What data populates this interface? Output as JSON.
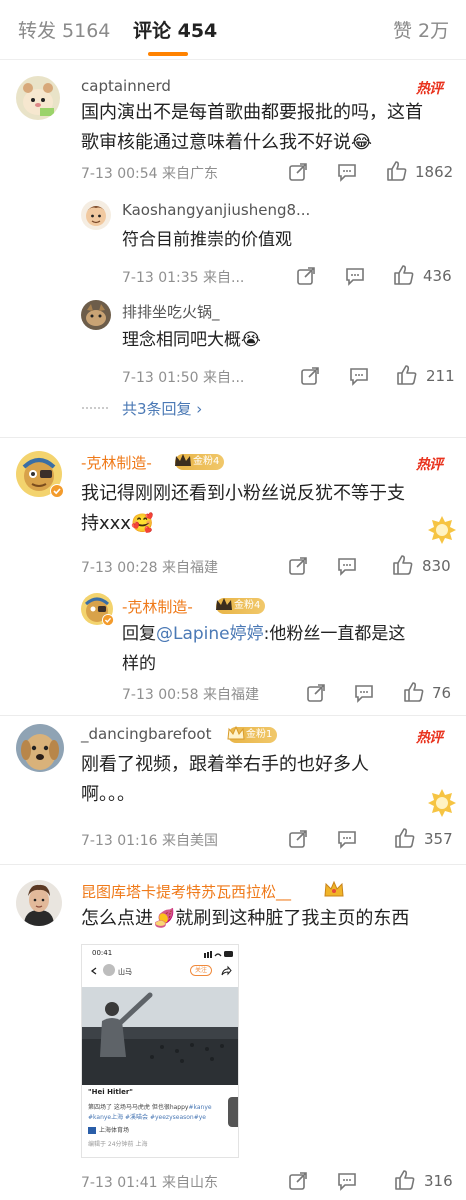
{
  "tabs": {
    "repost_label": "转发 5164",
    "comments_label": "评论 454",
    "likes_label": "赞 2万"
  },
  "comments": [
    {
      "username": "captainnerd",
      "hot_label": "热评",
      "text_lines": [
        "国内演出不是每首歌曲都要报批的吗，这首",
        "歌审核能通过意味着什么我不好说😂"
      ],
      "meta": "7-13 00:54  来自广东",
      "likes": "1862",
      "replies": [
        {
          "username": "Kaoshangyanjiusheng8...",
          "text": "符合目前推崇的价值观",
          "meta": "7-13 01:35  来自...",
          "likes": "436"
        },
        {
          "username": "排排坐吃火锅_",
          "text": "理念相同吧大概😭",
          "meta": "7-13 01:50  来自...",
          "likes": "211"
        }
      ],
      "more_replies": "共3条回复 ›"
    },
    {
      "username": "-克林制造-",
      "fan_badge": "金粉4",
      "hot_label": "热评",
      "text_lines": [
        "我记得刚刚还看到小粉丝说反犹不等于支",
        "持xxx🥰"
      ],
      "meta": "7-13 00:28  来自福建",
      "likes": "830",
      "reply": {
        "username": "-克林制造-",
        "fan_badge": "金粉4",
        "prefix": "回复",
        "mention": "@Lapine婷婷",
        "text_line1": ":他粉丝一直都是这",
        "text_line2": "样的",
        "meta": "7-13 00:58  来自福建",
        "likes": "76"
      }
    },
    {
      "username": "_dancingbarefoot",
      "fan_badge": "金粉1",
      "hot_label": "热评",
      "text_lines": [
        "刚看了视频，跟着举右手的也好多人",
        "啊。。。"
      ],
      "meta": "7-13 01:16  来自美国",
      "likes": "357"
    },
    {
      "username": "昆图库塔卡提考特苏瓦西拉松__",
      "text": "怎么点进🍠就刷到这种脏了我主页的东西",
      "meta": "7-13 01:41  来自山东",
      "likes": "316",
      "embedded_screenshot": {
        "status_time": "00:41",
        "account": "山马",
        "follow_label": "关注",
        "caption": "\"Hei Hitler\"",
        "line1": "第四场了 这场马马虎虎 但也很happy",
        "tag1": "#kanye",
        "tag2": "#kanye上海 #溪喵会 #yeezyseason#ye",
        "venue": "上海体育场",
        "edited": "编辑于 24分钟前 上海"
      }
    }
  ],
  "colors": {
    "accent_orange": "#ff8200",
    "hot_red": "#e9331e",
    "link_blue": "#4b79b5",
    "username_orange": "#ef7a1a"
  }
}
